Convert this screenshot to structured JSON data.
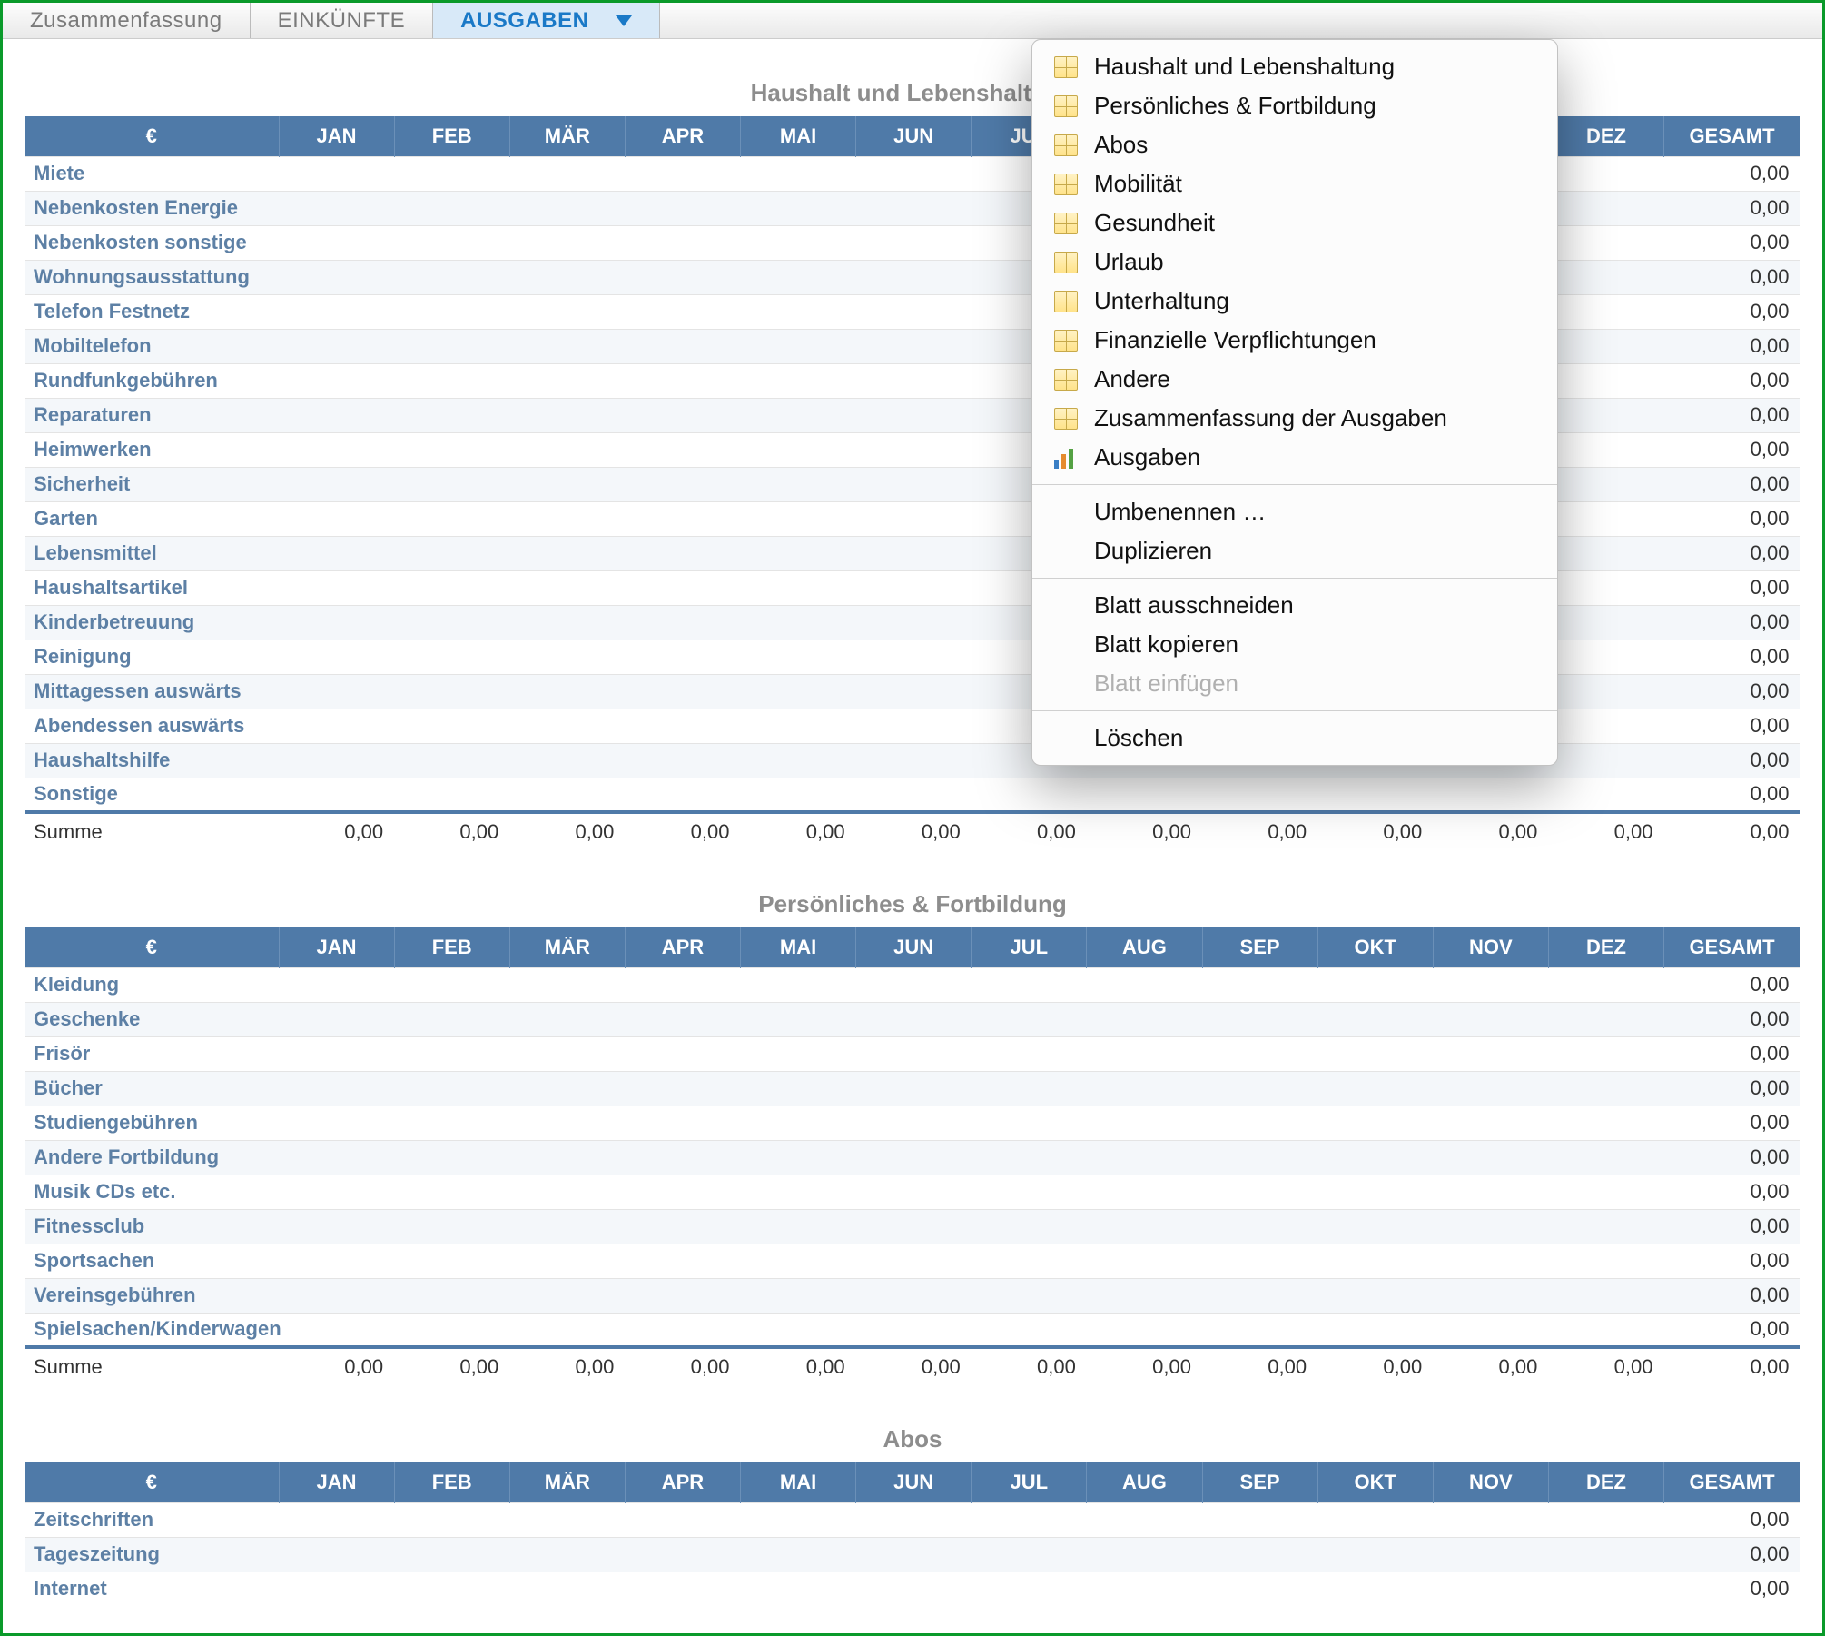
{
  "tabs": {
    "summary": "Zusammenfassung",
    "income": "EINKÜNFTE",
    "expenses": "AUSGABEN"
  },
  "months": [
    "JAN",
    "FEB",
    "MÄR",
    "APR",
    "MAI",
    "JUN",
    "JUL",
    "AUG",
    "SEP",
    "OKT",
    "NOV",
    "DEZ"
  ],
  "currency_header": "€",
  "total_header": "GESAMT",
  "sum_label": "Summe",
  "zero": "0,00",
  "menu": {
    "sheets": [
      "Haushalt und Lebenshaltung",
      "Persönliches & Fortbildung",
      "Abos",
      "Mobilität",
      "Gesundheit",
      "Urlaub",
      "Unterhaltung",
      "Finanzielle Verpflichtungen",
      "Andere",
      "Zusammenfassung der Ausgaben"
    ],
    "chart_item": "Ausgaben",
    "rename": "Umbenennen …",
    "duplicate": "Duplizieren",
    "cut": "Blatt ausschneiden",
    "copy": "Blatt kopieren",
    "paste": "Blatt einfügen",
    "delete": "Löschen"
  },
  "sections": [
    {
      "title": "Haushalt und Lebenshaltung",
      "rows": [
        "Miete",
        "Nebenkosten Energie",
        "Nebenkosten sonstige",
        "Wohnungsausstattung",
        "Telefon Festnetz",
        "Mobiltelefon",
        "Rundfunkgebühren",
        "Reparaturen",
        "Heimwerken",
        "Sicherheit",
        "Garten",
        "Lebensmittel",
        "Haushaltsartikel",
        "Kinderbetreuung",
        "Reinigung",
        "Mittagessen auswärts",
        "Abendessen auswärts",
        "Haushaltshilfe",
        "Sonstige"
      ]
    },
    {
      "title": "Persönliches & Fortbildung",
      "rows": [
        "Kleidung",
        "Geschenke",
        "Frisör",
        "Bücher",
        "Studiengebühren",
        "Andere Fortbildung",
        "Musik CDs etc.",
        "Fitnessclub",
        "Sportsachen",
        "Vereinsgebühren",
        "Spielsachen/Kinderwagen"
      ]
    },
    {
      "title": "Abos",
      "rows": [
        "Zeitschriften",
        "Tageszeitung",
        "Internet"
      ]
    }
  ]
}
